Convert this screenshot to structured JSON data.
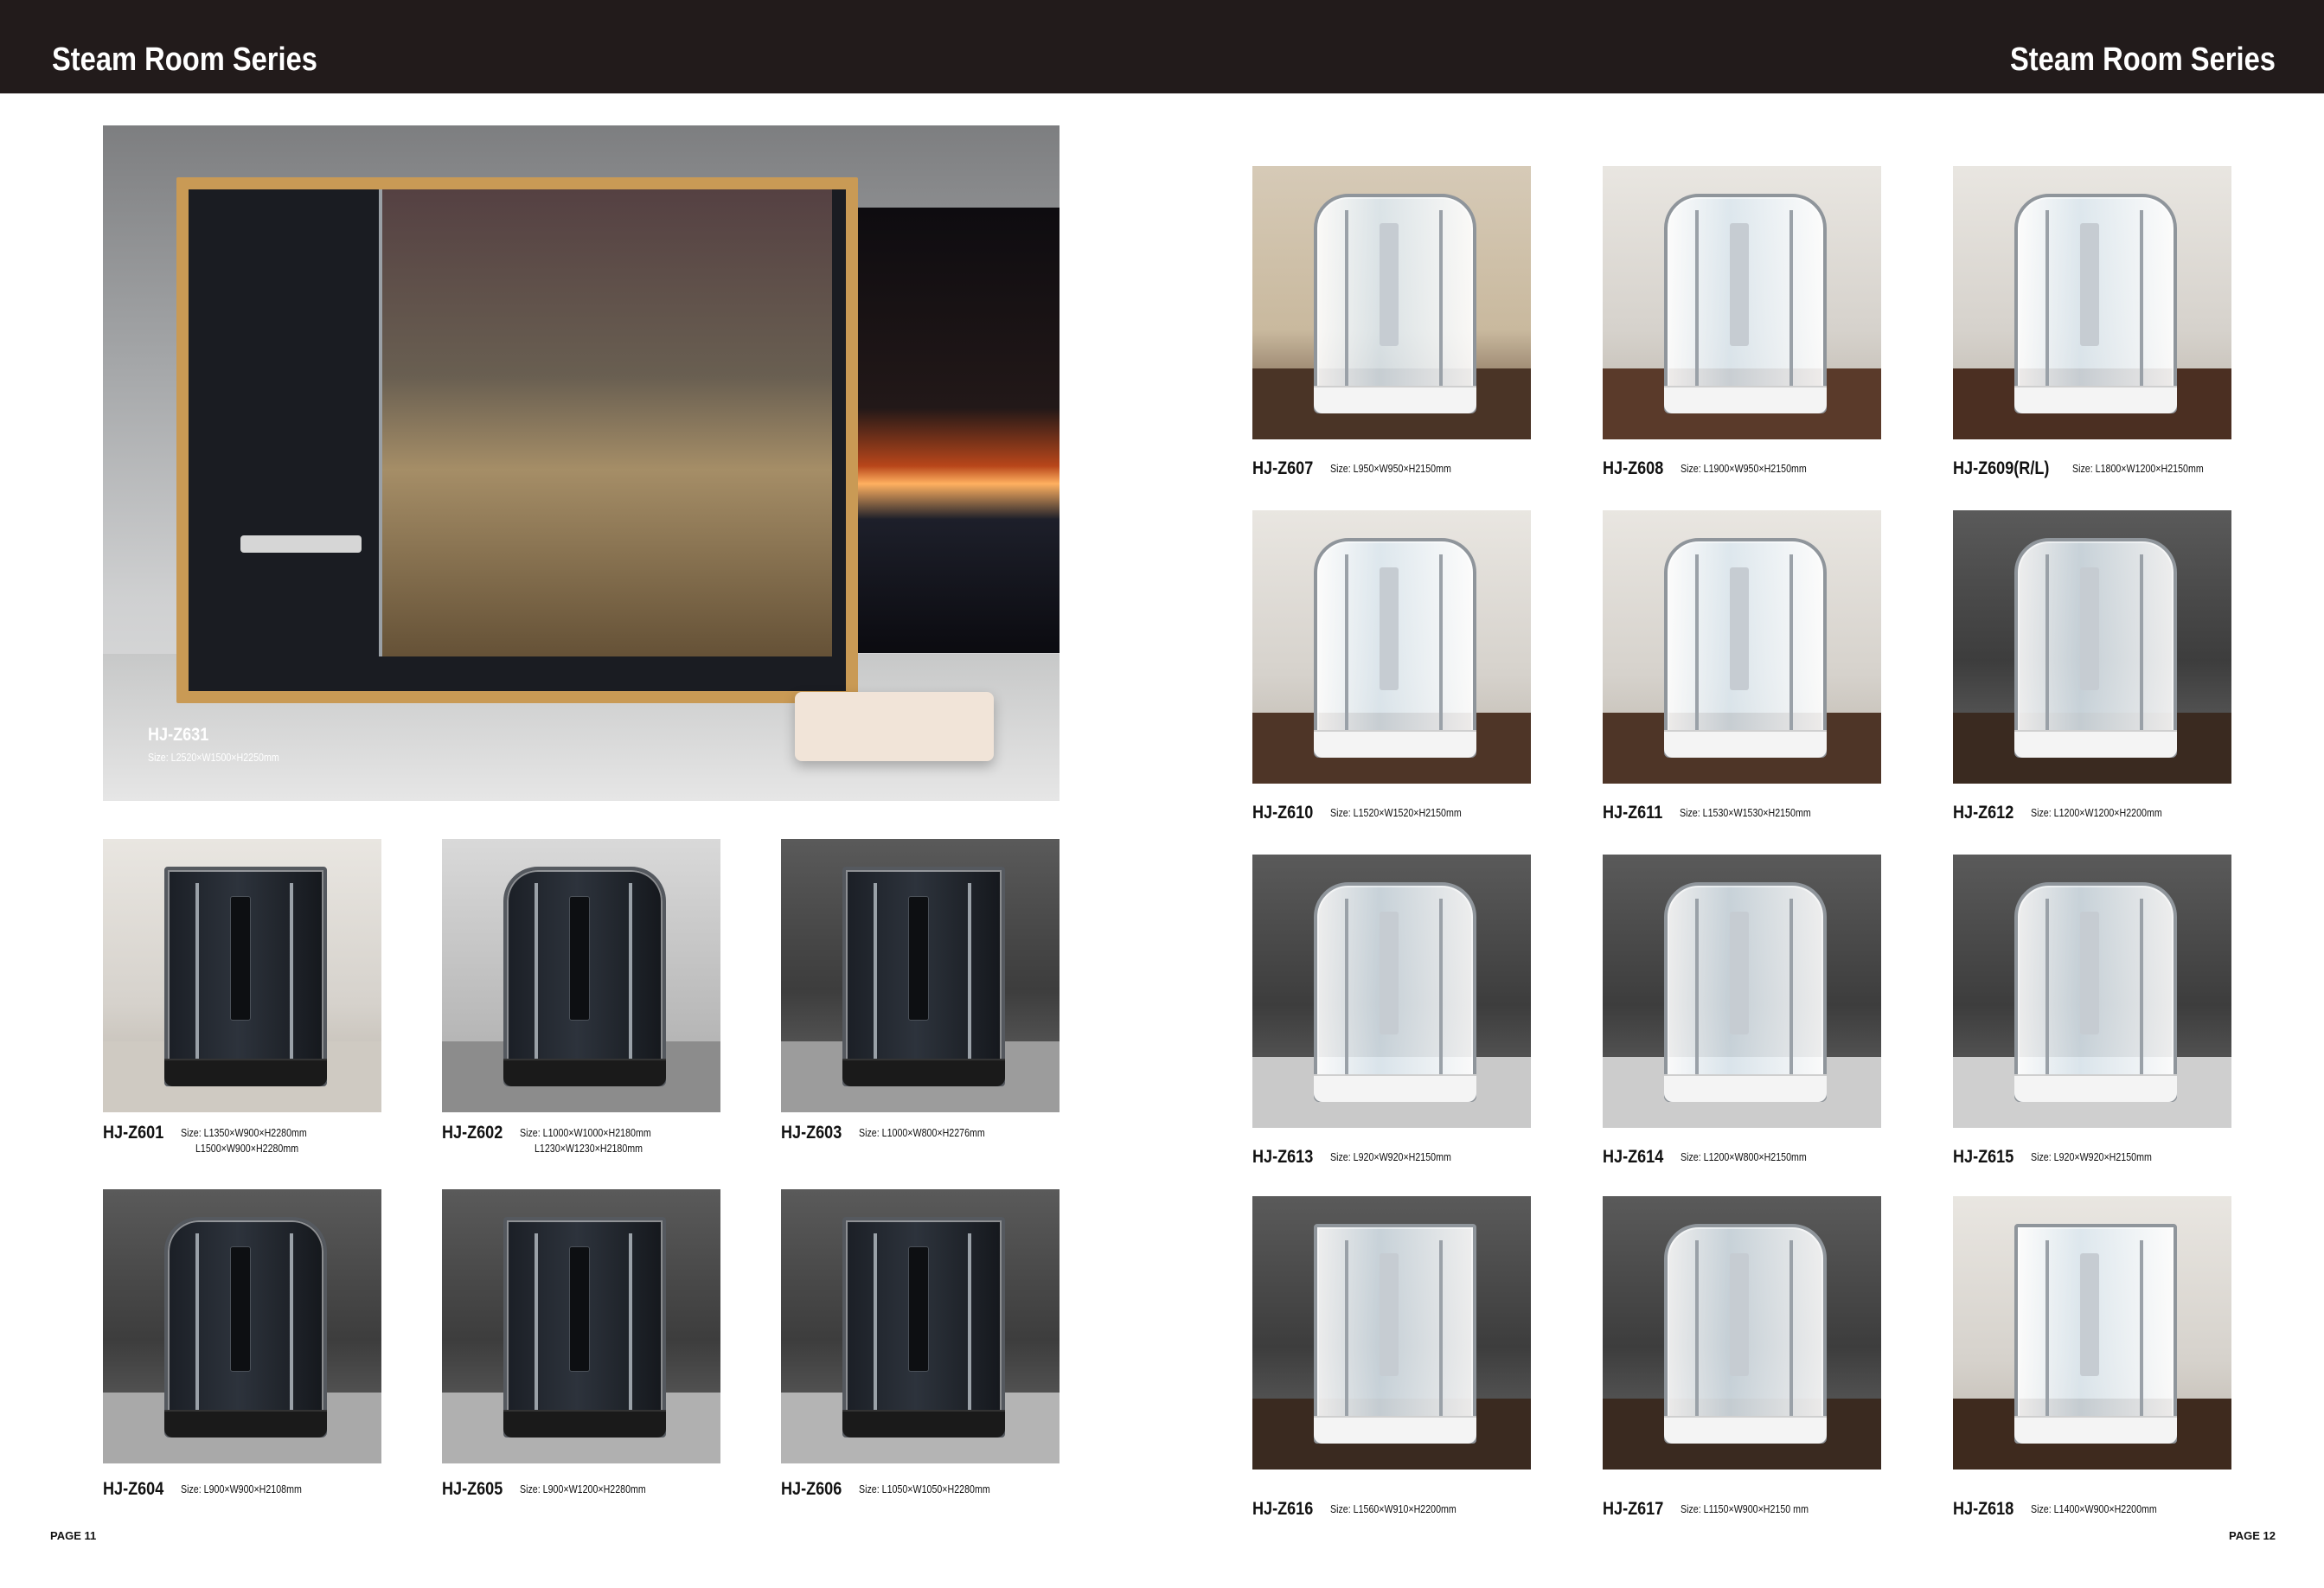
{
  "header": {
    "title_left": "Steam Room Series",
    "title_right": "Steam Room Series"
  },
  "hero": {
    "model": "HJ-Z631",
    "size": "Size: L2520×W1500×H2250mm"
  },
  "left_products": [
    {
      "model": "HJ-Z601",
      "size": "Size: L1350×W900×H2280mm",
      "size2": "L1500×W900×H2280mm"
    },
    {
      "model": "HJ-Z602",
      "size": "Size: L1000×W1000×H2180mm",
      "size2": "L1230×W1230×H2180mm"
    },
    {
      "model": "HJ-Z603",
      "size": "Size: L1000×W800×H2276mm"
    },
    {
      "model": "HJ-Z604",
      "size": "Size: L900×W900×H2108mm"
    },
    {
      "model": "HJ-Z605",
      "size": "Size: L900×W1200×H2280mm"
    },
    {
      "model": "HJ-Z606",
      "size": "Size: L1050×W1050×H2280mm"
    }
  ],
  "right_products": [
    {
      "model": "HJ-Z607",
      "size": "Size: L950×W950×H2150mm"
    },
    {
      "model": "HJ-Z608",
      "size": "Size: L1900×W950×H2150mm"
    },
    {
      "model": "HJ-Z609(R/L)",
      "size": "Size: L1800×W1200×H2150mm"
    },
    {
      "model": "HJ-Z610",
      "size": "Size: L1520×W1520×H2150mm"
    },
    {
      "model": "HJ-Z611",
      "size": "Size: L1530×W1530×H2150mm"
    },
    {
      "model": "HJ-Z612",
      "size": "Size: L1200×W1200×H2200mm"
    },
    {
      "model": "HJ-Z613",
      "size": "Size: L920×W920×H2150mm"
    },
    {
      "model": "HJ-Z614",
      "size": "Size: L1200×W800×H2150mm"
    },
    {
      "model": "HJ-Z615",
      "size": "Size: L920×W920×H2150mm"
    },
    {
      "model": "HJ-Z616",
      "size": "Size: L1560×W910×H2200mm"
    },
    {
      "model": "HJ-Z617",
      "size": "Size: L1150×W900×H2150 mm"
    },
    {
      "model": "HJ-Z618",
      "size": "Size: L1400×W900×H2200mm"
    }
  ],
  "footer": {
    "page_left": "PAGE 11",
    "page_right": "PAGE 12"
  }
}
